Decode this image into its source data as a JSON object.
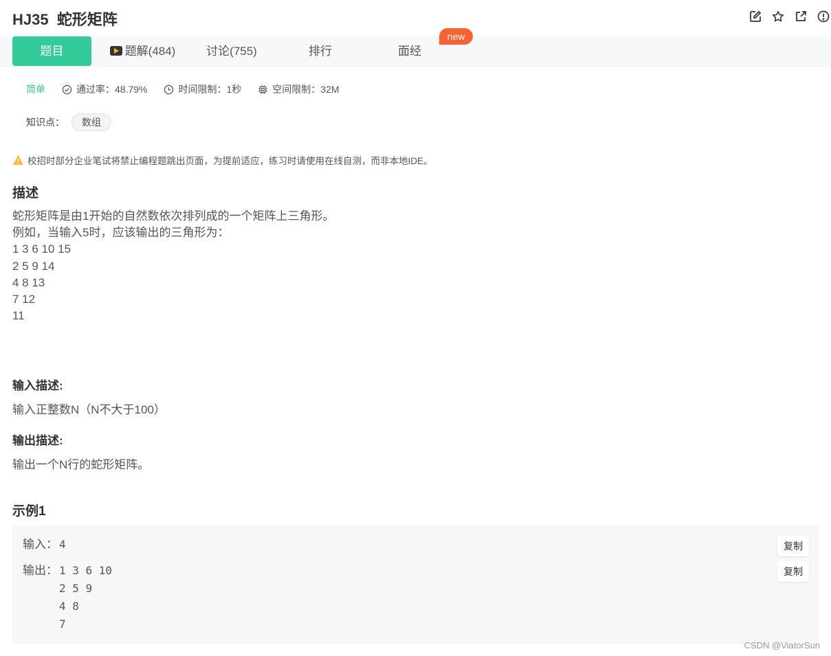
{
  "header": {
    "title": "HJ35  蛇形矩阵",
    "icons": [
      "edit-icon",
      "star-icon",
      "share-icon",
      "report-icon"
    ]
  },
  "tabs": [
    {
      "label": "题目",
      "active": true
    },
    {
      "label": "题解(484)",
      "icon": "video-icon"
    },
    {
      "label": "讨论(755)"
    },
    {
      "label": "排行"
    },
    {
      "label": "面经",
      "badge": "new"
    }
  ],
  "meta": {
    "level": "简单",
    "pass_rate": "通过率：48.79%",
    "time_limit": "时间限制：1秒",
    "space_limit": "空间限制：32M"
  },
  "knowledge": {
    "label": "知识点：",
    "tag": "数组"
  },
  "warning": "校招时部分企业笔试将禁止编程题跳出页面，为提前适应，练习时请使用在线自测，而非本地IDE。",
  "description": {
    "title": "描述",
    "lines": [
      "蛇形矩阵是由1开始的自然数依次排列成的一个矩阵上三角形。",
      "例如，当输入5时，应该输出的三角形为：",
      "1 3 6 10 15",
      "2 5 9 14",
      "4 8 13",
      "7 12",
      "11"
    ]
  },
  "input_desc": {
    "title": "输入描述:",
    "text": "输入正整数N（N不大于100）"
  },
  "output_desc": {
    "title": "输出描述:",
    "text": "输出一个N行的蛇形矩阵。"
  },
  "example": {
    "title": "示例1",
    "input_label": "输入：",
    "input_value": "4",
    "output_label": "输出：",
    "output_value": "1 3 6 10\n2 5 9\n4 8\n7",
    "copy_label": "复制"
  },
  "watermark": "CSDN @ViatorSun",
  "colors": {
    "accent": "#32ca99",
    "badge": "#fa6232",
    "warning": "#f5b933"
  }
}
